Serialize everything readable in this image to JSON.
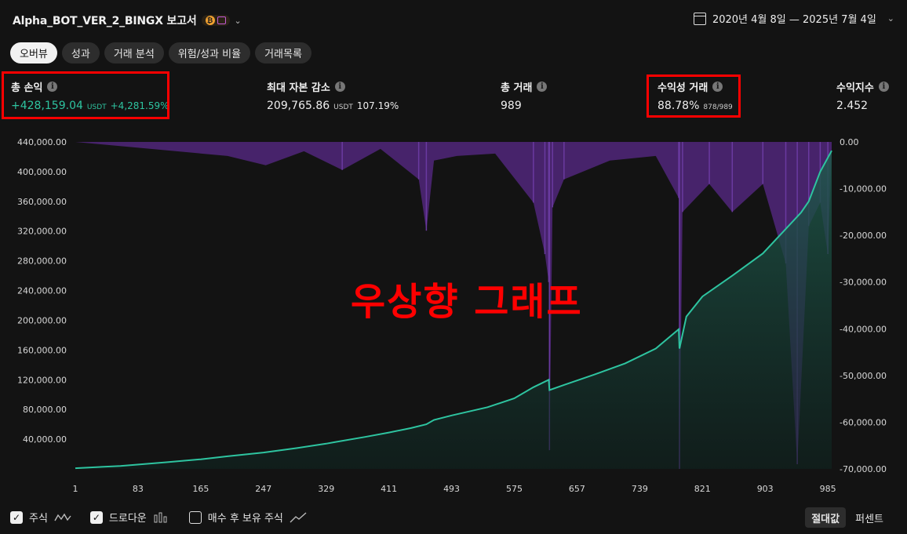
{
  "header": {
    "title": "Alpha_BOT_VER_2_BINGX 보고서",
    "coin_symbol": "₿",
    "date_range": "2020년 4월 8일 — 2025년 7월 4일"
  },
  "tabs": [
    {
      "label": "오버뷰",
      "active": true
    },
    {
      "label": "성과",
      "active": false
    },
    {
      "label": "거래 분석",
      "active": false
    },
    {
      "label": "위험/성과 비율",
      "active": false
    },
    {
      "label": "거래목록",
      "active": false
    }
  ],
  "metrics": {
    "net_profit": {
      "label": "총 손익",
      "value": "+428,159.04",
      "unit": "USDT",
      "percent": "+4,281.59%"
    },
    "max_drawdown": {
      "label": "최대 자본 감소",
      "value": "209,765.86",
      "unit": "USDT",
      "percent": "107.19%"
    },
    "total_trades": {
      "label": "총 거래",
      "value": "989"
    },
    "profitable": {
      "label": "수익성 거래",
      "value": "88.78%",
      "sub": "878/989"
    },
    "profit_factor": {
      "label": "수익지수",
      "value": "2.452"
    }
  },
  "annotation": {
    "text": "우상향 그래프",
    "color": "#ff0000"
  },
  "chart_data": {
    "type": "area",
    "y_left_ticks": [
      "440,000.00",
      "400,000.00",
      "360,000.00",
      "320,000.00",
      "280,000.00",
      "240,000.00",
      "200,000.00",
      "160,000.00",
      "120,000.00",
      "80,000.00",
      "40,000.00"
    ],
    "y_right_ticks": [
      "0.00",
      "-10,000.00",
      "-20,000.00",
      "-30,000.00",
      "-40,000.00",
      "-50,000.00",
      "-60,000.00",
      "-70,000.00"
    ],
    "x_ticks": [
      "1",
      "83",
      "165",
      "247",
      "329",
      "411",
      "493",
      "575",
      "657",
      "739",
      "821",
      "903",
      "985"
    ],
    "ylim_left": [
      0,
      440000
    ],
    "ylim_right": [
      -70000,
      0
    ],
    "xlim": [
      1,
      990
    ],
    "series": [
      {
        "name": "주식",
        "color": "#2ec4a0",
        "x": [
          1,
          60,
          120,
          165,
          200,
          247,
          290,
          329,
          340,
          380,
          411,
          440,
          460,
          470,
          493,
          540,
          575,
          600,
          620,
          621,
          640,
          680,
          720,
          760,
          790,
          791,
          800,
          821,
          860,
          900,
          930,
          950,
          960,
          975,
          990
        ],
        "y": [
          1000,
          4000,
          9000,
          13000,
          17000,
          22000,
          28000,
          34000,
          36000,
          43000,
          49000,
          55000,
          60000,
          66000,
          72000,
          83000,
          95000,
          110000,
          120000,
          106000,
          113000,
          127000,
          142000,
          162000,
          188000,
          162000,
          205000,
          232000,
          260000,
          290000,
          323000,
          345000,
          360000,
          400000,
          428159
        ]
      },
      {
        "name": "드로다운",
        "color": "#5a2a8a",
        "x": [
          1,
          100,
          200,
          250,
          300,
          350,
          400,
          450,
          460,
          470,
          500,
          550,
          600,
          615,
          620,
          621,
          625,
          640,
          700,
          760,
          790,
          791,
          795,
          830,
          860,
          900,
          930,
          945,
          960,
          975,
          985,
          990
        ],
        "y": [
          0,
          -1500,
          -3000,
          -5000,
          -2000,
          -6000,
          -1500,
          -8000,
          -19000,
          -4000,
          -3000,
          -2500,
          -13000,
          -24000,
          -30000,
          -66000,
          -14000,
          -8000,
          -4000,
          -3000,
          -12000,
          -70000,
          -15000,
          -9000,
          -15000,
          -9000,
          -26000,
          -69000,
          -18000,
          -13000,
          -24000,
          -2000
        ]
      }
    ]
  },
  "legend": {
    "equity": {
      "label": "주식",
      "checked": true
    },
    "drawdown": {
      "label": "드로다운",
      "checked": true
    },
    "buyhold": {
      "label": "매수 후 보유 주식",
      "checked": false
    }
  },
  "toggle": {
    "absolute": "절대값",
    "percent": "퍼센트"
  }
}
